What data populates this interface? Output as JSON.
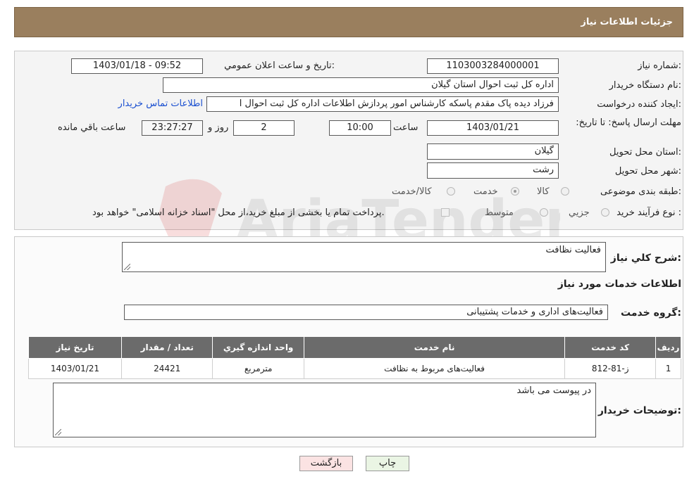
{
  "header": {
    "title": "جزئیات اطلاعات نیاز"
  },
  "form": {
    "need_number_label": "شماره نیاز:",
    "need_number": "1103003284000001",
    "announce_label": "تاریخ و ساعت اعلان عمومي:",
    "announce_value": "1403/01/18 - 09:52",
    "buyer_org_label": "نام دستگاه خريدار:",
    "buyer_org": "اداره کل ثبت احوال استان گیلان",
    "creator_label": "ايجاد کننده درخواست:",
    "creator": "فرزاد دیده پاک مقدم پاسکه کارشناس امور پردازش اطلاعات اداره کل ثبت احوال ا",
    "contact_link": "اطلاعات تماس خريدار",
    "deadline_label": "مهلت ارسال پاسخ: تا تاريخ:",
    "deadline_date": "1403/01/21",
    "time_label": "ساعت",
    "deadline_time": "10:00",
    "days_value": "2",
    "days_label": "روز و",
    "remaining_time": "23:27:27",
    "remaining_label": "ساعت باقي مانده",
    "province_label": "استان محل تحويل:",
    "province": "گیلان",
    "city_label": "شهر محل تحويل:",
    "city": "رشت",
    "category_label": "طبقه بندی موضوعی:",
    "category_options": [
      "کالا",
      "خدمت",
      "کالا/خدمت"
    ],
    "process_label": "نوع فرآيند خريد :",
    "process_options": [
      "جزيي",
      "متوسط"
    ],
    "payment_note": "پرداخت تمام یا بخشی از مبلغ خرید،از محل \"اسناد خزانه اسلامی\" خواهد بود."
  },
  "details": {
    "summary_label": "شرح کلي نياز:",
    "summary_value": "فعالیت نظافت",
    "services_heading": "اطلاعات خدمات مورد نياز",
    "group_label": "گروه خدمت:",
    "group_value": "فعالیت‌های اداری و خدمات پشتیبانی"
  },
  "table": {
    "headers": [
      "رديف",
      "کد خدمت",
      "نام خدمت",
      "واحد اندازه گيري",
      "تعداد / مقدار",
      "تاريخ نياز"
    ],
    "rows": [
      {
        "index": "1",
        "code": "ز-81-812",
        "name": "فعالیت‌های مربوط به نظافت",
        "unit": "مترمربع",
        "qty": "24421",
        "date": "1403/01/21"
      }
    ]
  },
  "buyer_notes": {
    "label": "توضيحات خريدار:",
    "value": "در پیوست می باشد"
  },
  "buttons": {
    "print": "چاپ",
    "back": "بازگشت"
  },
  "watermark_text": "AriaTender.net"
}
